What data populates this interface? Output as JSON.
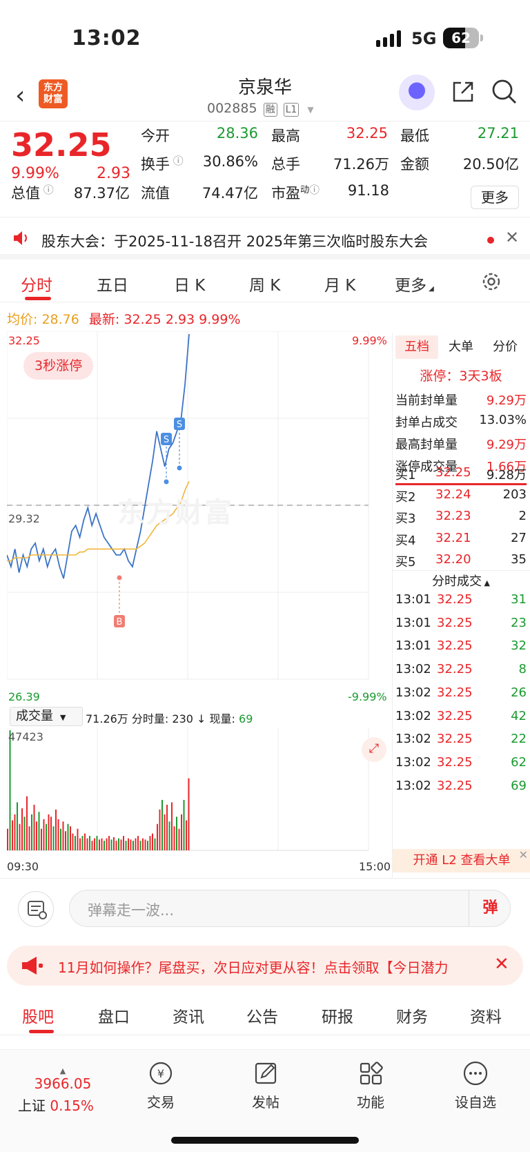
{
  "status_bar": {
    "time": "13:02",
    "network": "5G",
    "battery": "62",
    "battery_level": 0.62
  },
  "header": {
    "back_icon": "chevron-left-icon",
    "logo_text": "东方\n财富",
    "stock_name": "京泉华",
    "stock_code": "002885",
    "tag_margin": "融",
    "tag_level": "L1",
    "icons": [
      "robot-icon",
      "share-icon",
      "search-icon"
    ]
  },
  "quote": {
    "price": "32.25",
    "change_pct": "9.99%",
    "change": "2.93",
    "open_label": "今开",
    "open": "28.36",
    "high_label": "最高",
    "high": "32.25",
    "low_label": "最低",
    "low": "27.21",
    "turnover_label": "换手",
    "turnover": "30.86%",
    "volume_label": "总手",
    "volume": "71.26万",
    "amount_label": "金额",
    "amount": "20.50亿",
    "mcap_label": "总值",
    "mcap": "87.37亿",
    "float_label": "流值",
    "float_cap": "74.47亿",
    "pe_label": "市盈",
    "pe_sup": "动",
    "pe": "91.18",
    "more_button": "更多"
  },
  "notice": {
    "text": "股东大会：于2025-11-18召开 2025年第三次临时股东大会"
  },
  "chart_tabs": [
    "分时",
    "五日",
    "日 K",
    "周 K",
    "月 K",
    "更多"
  ],
  "intraday": {
    "avg_label": "均价:",
    "avg_value": "28.76",
    "latest_label": "最新:",
    "latest_value": "32.25",
    "latest_change": "2.93",
    "latest_pct": "9.99%",
    "top_price": "32.25",
    "top_pct": "9.99%",
    "mid_price": "29.32",
    "bottom_price": "26.39",
    "bottom_pct": "-9.99%",
    "badge": "3秒涨停",
    "watermark": "东方财富",
    "markers": [
      {
        "label": "S"
      },
      {
        "label": "S"
      },
      {
        "label": "B"
      }
    ],
    "vol_selector": "成交量",
    "vol_total": "71.26万",
    "vol_minute_label": "分时量:",
    "vol_minute": "230",
    "vol_now_label": "现量:",
    "vol_now": "69",
    "vol_max": "47423",
    "time_start": "09:30",
    "time_end": "15:00"
  },
  "chart_data": {
    "type": "line",
    "title": "",
    "xlabel": "",
    "ylabel": "",
    "ylim": [
      26.39,
      32.25
    ],
    "x_range": [
      "09:30",
      "15:00"
    ],
    "series": [
      {
        "values": [
          28.5,
          28.3,
          28.6,
          28.2,
          28.5,
          28.3,
          28.6,
          28.7,
          28.4,
          28.6,
          28.3,
          28.5,
          28.6,
          28.3,
          28.1,
          28.5,
          28.9,
          29.0,
          28.8,
          29.1,
          29.3,
          29.0,
          29.2,
          29.0,
          28.8,
          28.7,
          28.6,
          28.5,
          28.5,
          28.6,
          28.4,
          28.3,
          28.6,
          28.9,
          29.3,
          29.7,
          30.1,
          30.6,
          30.3,
          30.0,
          30.3,
          30.4,
          30.6,
          30.8,
          31.4,
          32.25
        ]
      },
      {
        "values": [
          28.4,
          28.4,
          28.45,
          28.45,
          28.45,
          28.45,
          28.5,
          28.5,
          28.5,
          28.5,
          28.5,
          28.5,
          28.5,
          28.5,
          28.5,
          28.5,
          28.5,
          28.5,
          28.55,
          28.55,
          28.6,
          28.6,
          28.6,
          28.6,
          28.6,
          28.6,
          28.6,
          28.6,
          28.6,
          28.6,
          28.6,
          28.6,
          28.6,
          28.65,
          28.7,
          28.8,
          28.9,
          29.0,
          29.05,
          29.1,
          29.15,
          29.2,
          29.3,
          29.4,
          29.6,
          29.75
        ]
      }
    ]
  },
  "volume_bars": [
    18,
    100,
    25,
    30,
    40,
    22,
    35,
    28,
    45,
    20,
    30,
    38,
    24,
    32,
    18,
    26,
    22,
    30,
    28,
    20,
    34,
    26,
    18,
    24,
    16,
    22,
    20,
    14,
    12,
    18,
    10,
    12,
    14,
    10,
    12,
    8,
    10,
    12,
    9,
    10,
    8,
    10,
    12,
    9,
    11,
    8,
    10,
    9,
    12,
    8,
    10,
    9,
    8,
    10,
    12,
    8,
    10,
    9,
    8,
    12,
    14,
    10,
    22,
    34,
    42,
    30,
    38,
    24,
    40,
    20,
    28,
    18,
    30,
    42,
    25,
    60
  ],
  "order_book": {
    "tabs": [
      "五档",
      "大单",
      "分价"
    ],
    "limit_label": "涨停：3天3板",
    "stats": [
      {
        "label": "当前封单量",
        "value": "9.29万",
        "color": "red"
      },
      {
        "label": "封单占成交",
        "value": "13.03%",
        "color": "black"
      },
      {
        "label": "最高封单量",
        "value": "9.29万",
        "color": "red"
      },
      {
        "label": "涨停成交量",
        "value": "1.66万",
        "color": "red"
      }
    ],
    "bids": [
      {
        "label": "买1",
        "price": "32.25",
        "qty": "9.28万"
      },
      {
        "label": "买2",
        "price": "32.24",
        "qty": "203"
      },
      {
        "label": "买3",
        "price": "32.23",
        "qty": "2"
      },
      {
        "label": "买4",
        "price": "32.21",
        "qty": "27"
      },
      {
        "label": "买5",
        "price": "32.20",
        "qty": "35"
      }
    ],
    "ticks_title": "分时成交",
    "ticks": [
      {
        "time": "13:01",
        "price": "32.25",
        "qty": "31"
      },
      {
        "time": "13:01",
        "price": "32.25",
        "qty": "23"
      },
      {
        "time": "13:01",
        "price": "32.25",
        "qty": "32"
      },
      {
        "time": "13:02",
        "price": "32.25",
        "qty": "8"
      },
      {
        "time": "13:02",
        "price": "32.25",
        "qty": "26"
      },
      {
        "time": "13:02",
        "price": "32.25",
        "qty": "42"
      },
      {
        "time": "13:02",
        "price": "32.25",
        "qty": "22"
      },
      {
        "time": "13:02",
        "price": "32.25",
        "qty": "62"
      },
      {
        "time": "13:02",
        "price": "32.25",
        "qty": "69"
      }
    ],
    "l2_banner": "开通 L2 查看大单"
  },
  "comment": {
    "placeholder": "弹幕走一波...",
    "danmu_button": "弹"
  },
  "promo": {
    "text": "11月如何操作？尾盘买，次日应对更从容！点击领取【今日潜力"
  },
  "bottom_tabs": [
    "股吧",
    "盘口",
    "资讯",
    "公告",
    "研报",
    "财务",
    "资料"
  ],
  "tab_bar": {
    "index_value": "3966.05",
    "index_name": "上证",
    "index_pct": "0.15%",
    "items": [
      {
        "label": "交易",
        "icon": "trade-yen-icon"
      },
      {
        "label": "发帖",
        "icon": "edit-icon"
      },
      {
        "label": "功能",
        "icon": "grid-icon"
      },
      {
        "label": "设自选",
        "icon": "more-dots-icon"
      }
    ]
  },
  "colors": {
    "up": "#e8262a",
    "down": "#1a9a2f",
    "price_line": "#3b73c7",
    "avg_line": "#f1b537"
  }
}
